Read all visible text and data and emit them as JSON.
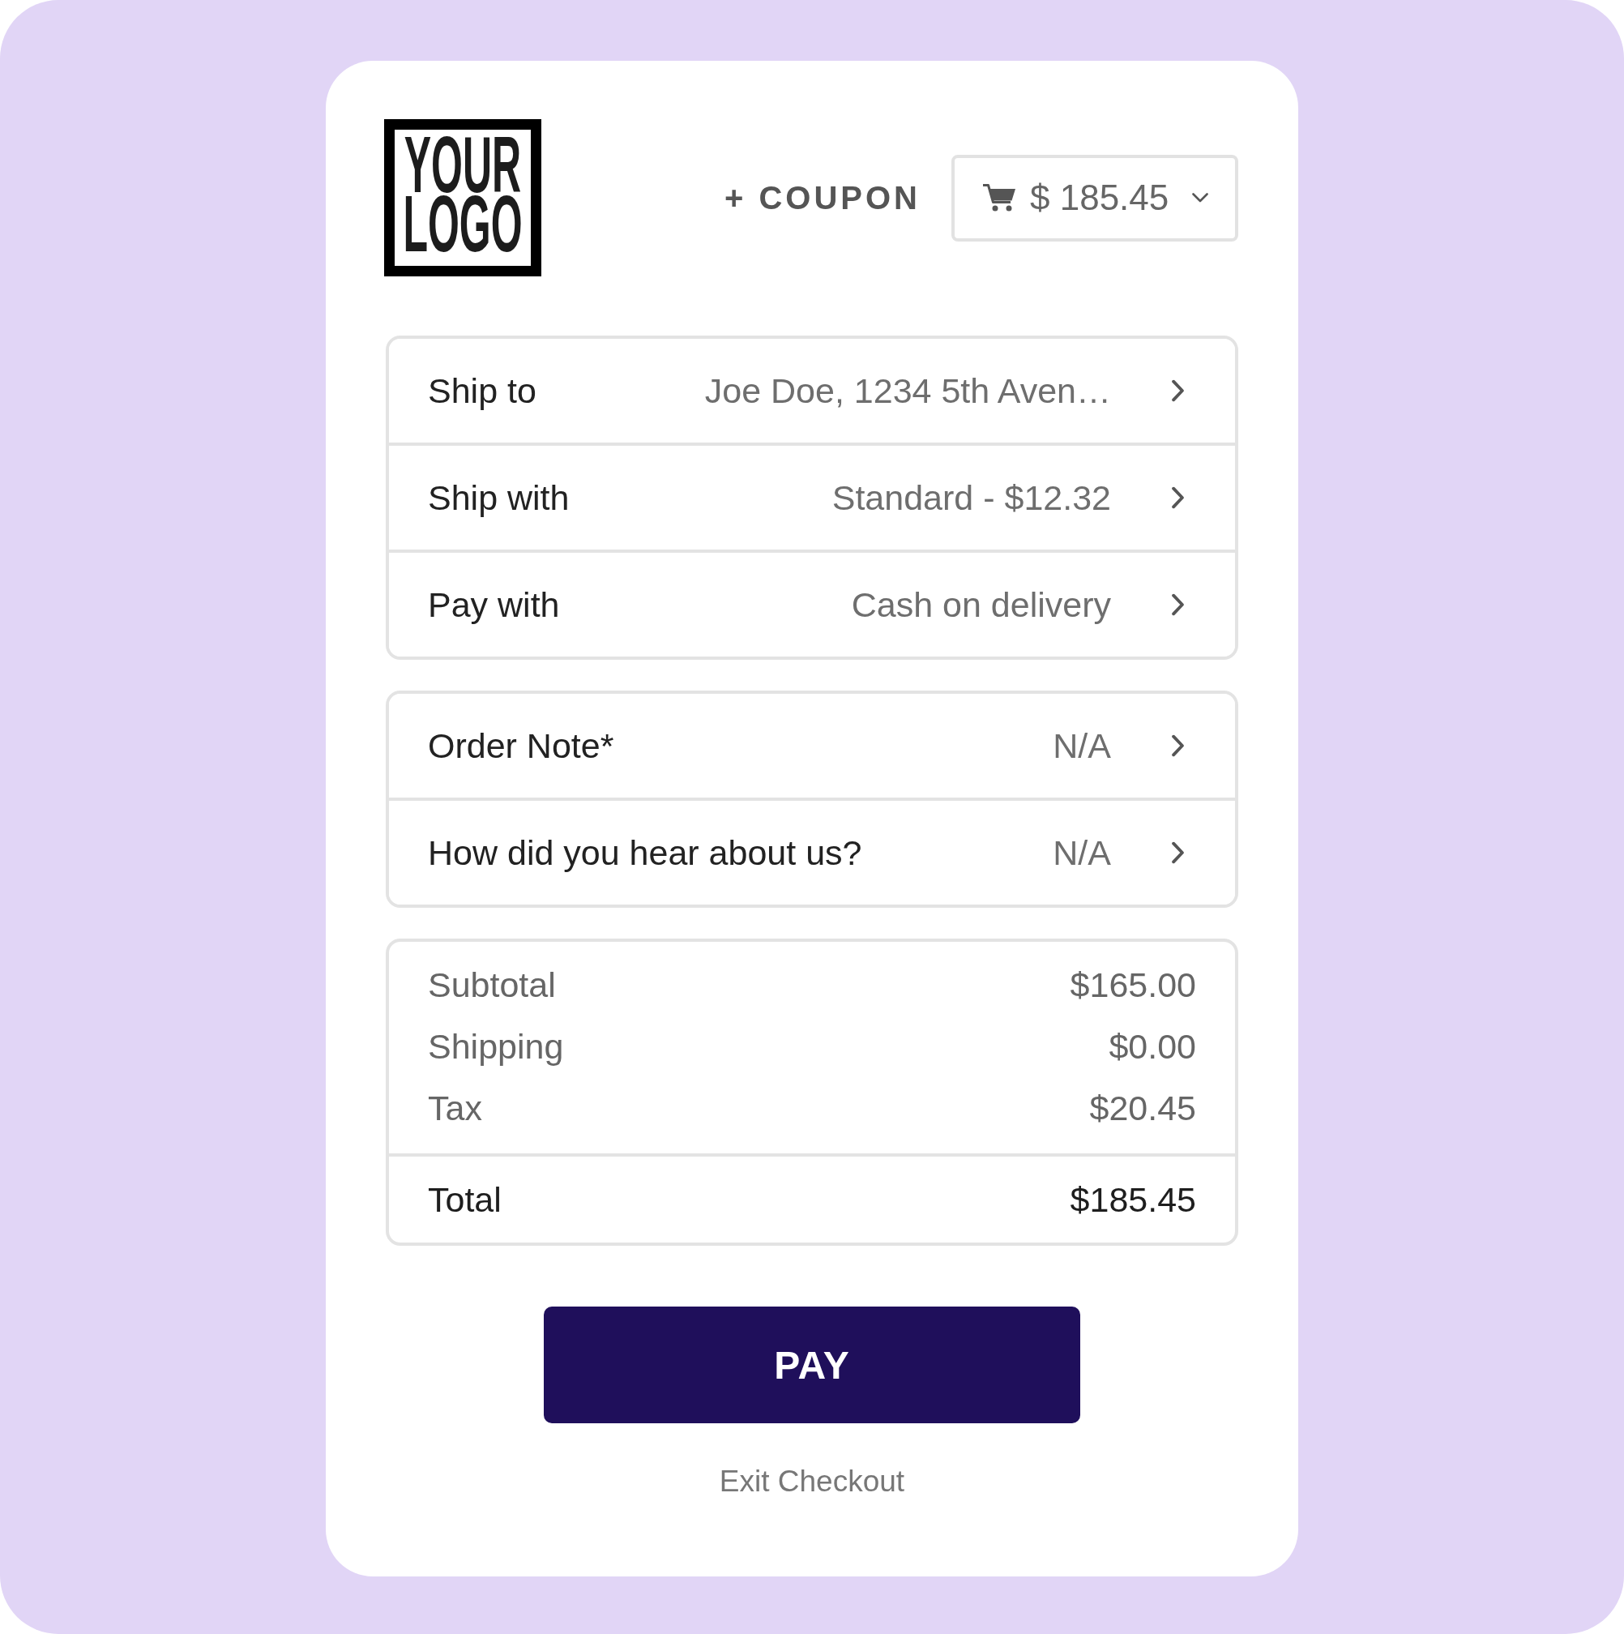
{
  "logo": {
    "lines": [
      "YOUR",
      "LOGO"
    ]
  },
  "header": {
    "coupon": "+ COUPON",
    "cart_total": "$ 185.45"
  },
  "sections": [
    {
      "rows": [
        {
          "label": "Ship to",
          "value": "Joe Doe, 1234 5th Aven…"
        },
        {
          "label": "Ship with",
          "value": "Standard - $12.32"
        },
        {
          "label": "Pay with",
          "value": "Cash on delivery"
        }
      ]
    },
    {
      "rows": [
        {
          "label": "Order Note*",
          "value": "N/A"
        },
        {
          "label": "How did you hear about us?",
          "value": "N/A"
        }
      ]
    }
  ],
  "summary": {
    "lines": [
      {
        "label": "Subtotal",
        "value": "$165.00"
      },
      {
        "label": "Shipping",
        "value": "$0.00"
      },
      {
        "label": "Tax",
        "value": "$20.45"
      }
    ],
    "total": {
      "label": "Total",
      "value": "$185.45"
    }
  },
  "pay_button": "PAY",
  "exit_link": "Exit Checkout"
}
